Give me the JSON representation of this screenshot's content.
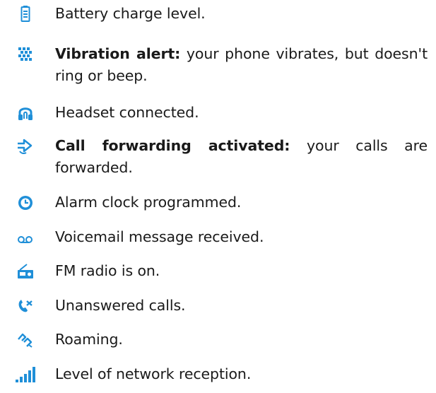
{
  "icon_color": "#1f8fd8",
  "items": [
    {
      "icon": "battery-icon",
      "text": "Battery charge level."
    },
    {
      "icon": "vibration-icon",
      "bold": "Vibration alert:",
      "text": " your phone vibrates, but doesn't ring or beep."
    },
    {
      "icon": "headset-icon",
      "text": "Headset connected."
    },
    {
      "icon": "call-forward-icon",
      "bold": "Call forwarding activated:",
      "text": " your calls are forwarded."
    },
    {
      "icon": "alarm-clock-icon",
      "text": "Alarm clock programmed."
    },
    {
      "icon": "voicemail-icon",
      "text": "Voicemail message received."
    },
    {
      "icon": "fm-radio-icon",
      "text": "FM radio is on."
    },
    {
      "icon": "missed-call-icon",
      "text": "Unanswered calls."
    },
    {
      "icon": "roaming-icon",
      "text": "Roaming."
    },
    {
      "icon": "signal-icon",
      "text": "Level of network reception."
    }
  ]
}
